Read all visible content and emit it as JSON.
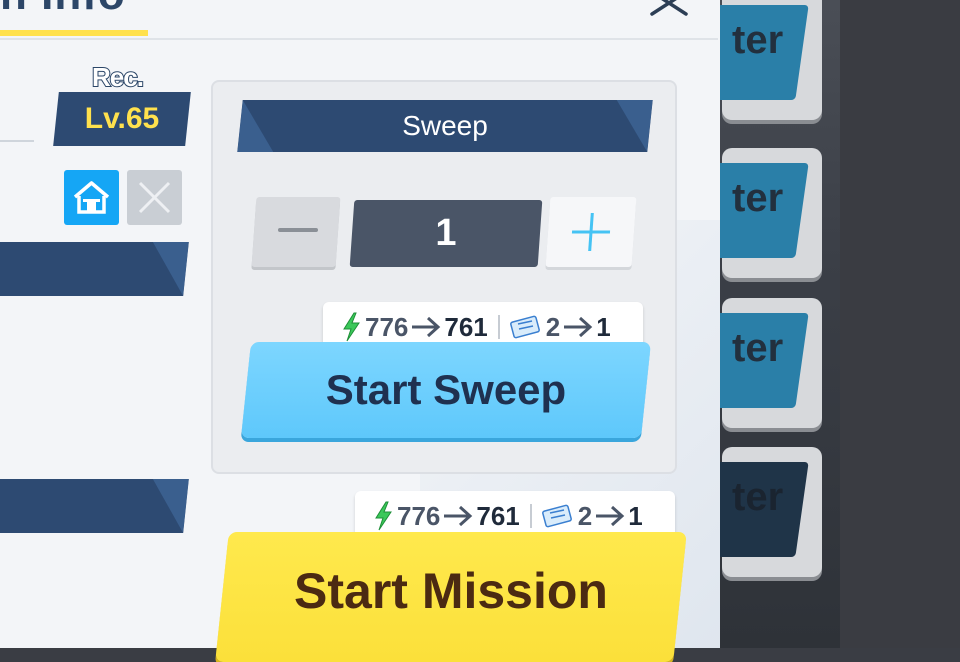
{
  "header": {
    "title_fragment": "n Info",
    "close_icon": "close-icon"
  },
  "recommended": {
    "label": "Rec.",
    "level": "Lv.65"
  },
  "icons": {
    "home": "home-icon",
    "close_gray": "x-icon"
  },
  "sweep": {
    "title": "Sweep",
    "quantity": "1",
    "minus_icon": "minus-icon",
    "plus_icon": "plus-icon",
    "cost": {
      "ap_from": "776",
      "ap_to": "761",
      "ticket_from": "2",
      "ticket_to": "1"
    },
    "button_label": "Start Sweep"
  },
  "mission": {
    "cost": {
      "ap_from": "776",
      "ap_to": "761",
      "ticket_from": "2",
      "ticket_to": "1"
    },
    "button_label": "Start Mission"
  },
  "side_buttons": [
    {
      "label": "ter"
    },
    {
      "label": "ter"
    },
    {
      "label": "ter"
    },
    {
      "label": "ter"
    }
  ],
  "colors": {
    "navy": "#2d4a72",
    "yellow_accent": "#ffe14d",
    "sweep_blue": "#5ec8fb",
    "mission_yellow": "#fbe03a",
    "home_blue": "#15a6f5"
  }
}
